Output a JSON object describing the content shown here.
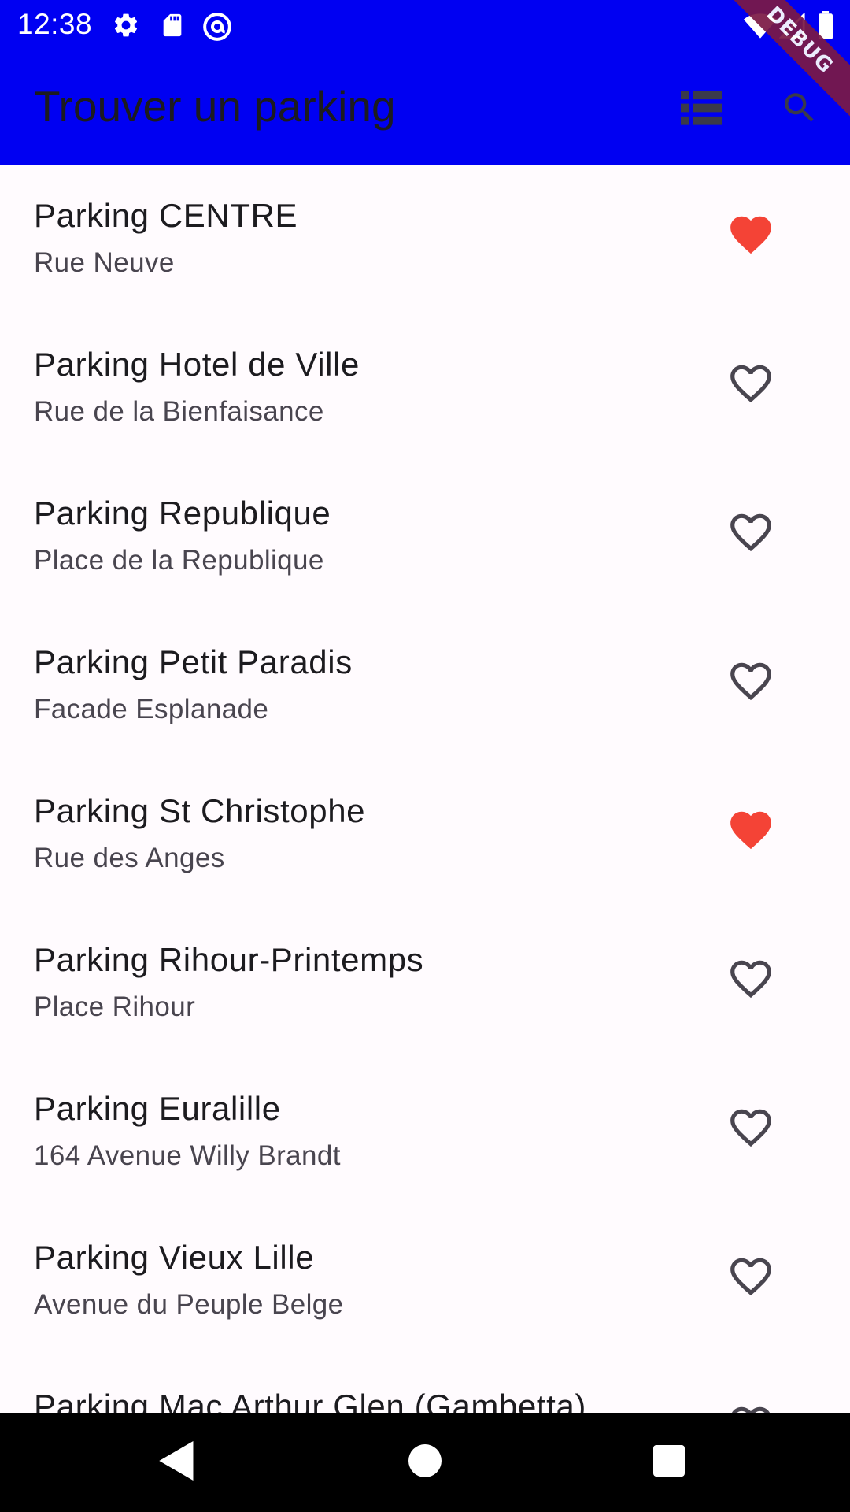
{
  "status_bar": {
    "time": "12:38",
    "left_icons": [
      "settings-icon",
      "sd-card-icon",
      "at-sign-icon"
    ],
    "right_icons": [
      "wifi-icon",
      "signal-icon",
      "battery-icon"
    ]
  },
  "debug_banner": "DEBUG",
  "app_bar": {
    "title": "Trouver un parking",
    "actions": [
      "list-view-icon",
      "search-icon"
    ]
  },
  "colors": {
    "app_bar_bg": "#0000f2",
    "favorite": "#f44336",
    "not_favorite": "#49454f",
    "background": "#fffbfe"
  },
  "parkings": [
    {
      "name": "Parking CENTRE",
      "address": "Rue Neuve",
      "favorite": true
    },
    {
      "name": "Parking Hotel de Ville",
      "address": "Rue de la Bienfaisance",
      "favorite": false
    },
    {
      "name": "Parking Republique",
      "address": "Place de la Republique",
      "favorite": false
    },
    {
      "name": "Parking Petit Paradis",
      "address": "Facade Esplanade",
      "favorite": false
    },
    {
      "name": "Parking St Christophe",
      "address": "Rue des Anges",
      "favorite": true
    },
    {
      "name": "Parking Rihour-Printemps",
      "address": "Place Rihour",
      "favorite": false
    },
    {
      "name": "Parking Euralille",
      "address": "164 Avenue Willy Brandt",
      "favorite": false
    },
    {
      "name": "Parking Vieux Lille",
      "address": "Avenue du Peuple Belge",
      "favorite": false
    },
    {
      "name": "Parking Mac Arthur Glen (Gambetta)",
      "address": "",
      "favorite": false
    }
  ],
  "nav_bar": [
    "back-icon",
    "home-icon",
    "recents-icon"
  ]
}
